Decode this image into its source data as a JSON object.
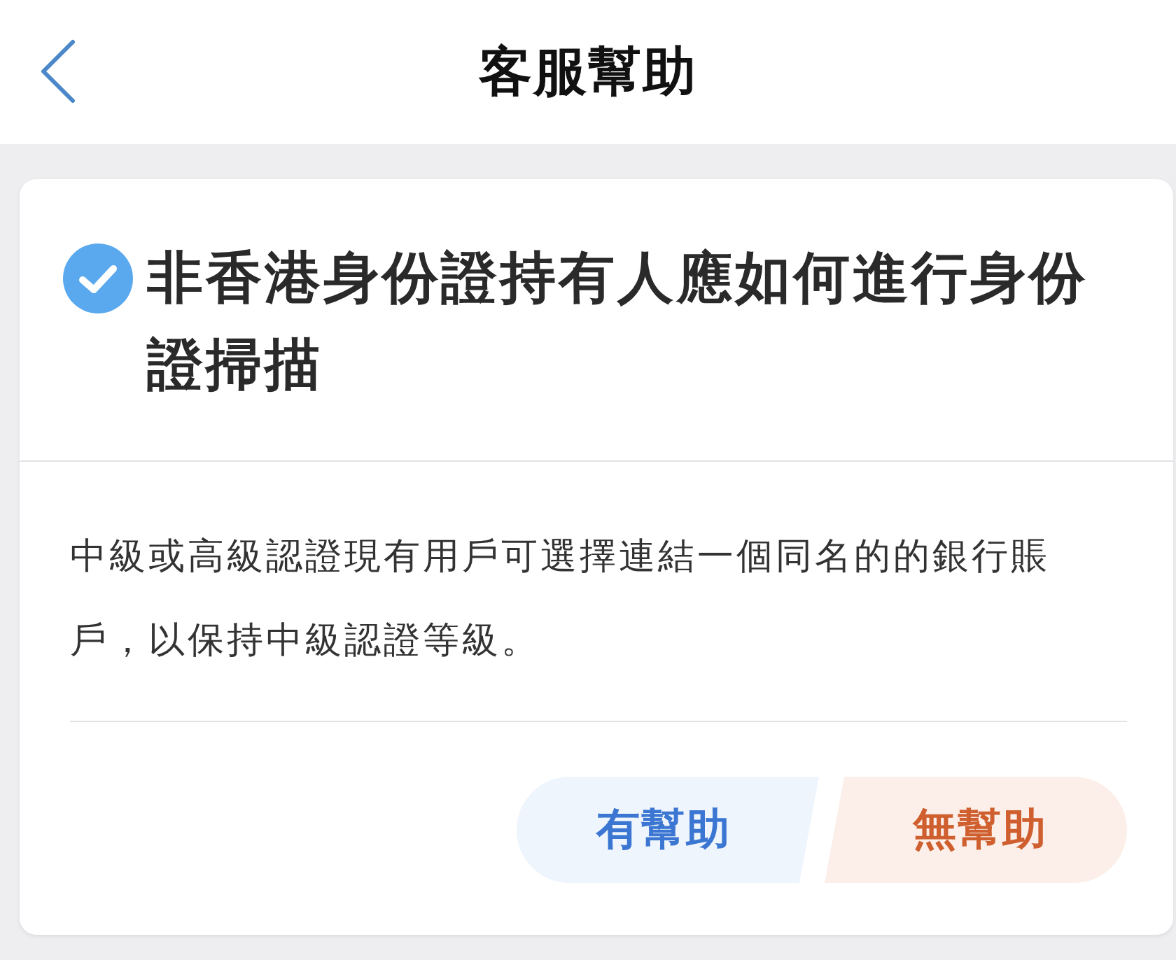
{
  "header": {
    "title": "客服幫助"
  },
  "article": {
    "title": "非香港身份證持有人應如何進行身份證掃描",
    "body": "中級或高級認證現有用戶可選擇連結一個同名的的銀行賬戶，以保持中級認證等級。"
  },
  "feedback": [
    {
      "label": "有幫助",
      "kind": "positive"
    },
    {
      "label": "無幫助",
      "kind": "negative"
    }
  ]
}
